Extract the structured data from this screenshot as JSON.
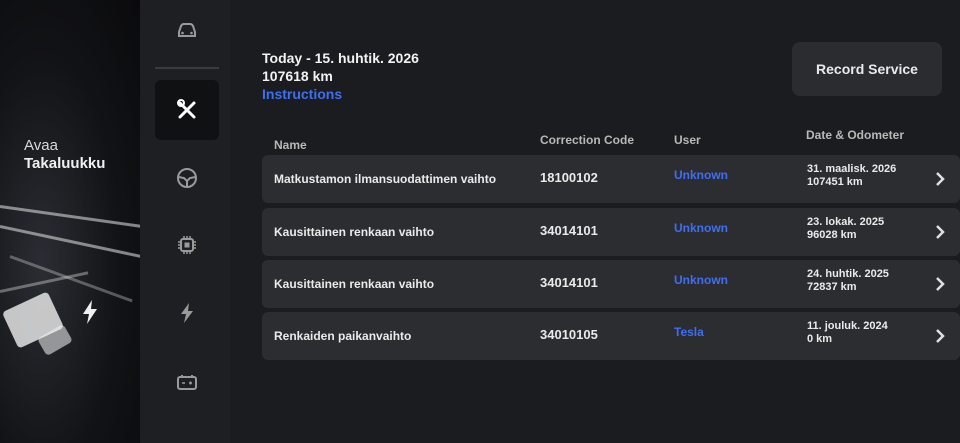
{
  "side_panel": {
    "trunk_label_line1": "Avaa",
    "trunk_label_line2": "Takaluukku"
  },
  "nav": {
    "items": [
      {
        "icon": "car-icon",
        "active": false
      },
      {
        "icon": "wrench-screwdriver-icon",
        "active": true
      },
      {
        "icon": "steering-wheel-icon",
        "active": false
      },
      {
        "icon": "chip-icon",
        "active": false
      },
      {
        "icon": "lightning-icon",
        "active": false
      },
      {
        "icon": "battery-icon",
        "active": false
      }
    ]
  },
  "header": {
    "date": "Today - 15. huhtik. 2026",
    "odometer": "107618 km",
    "instructions_link": "Instructions",
    "record_button": "Record Service"
  },
  "table": {
    "columns": [
      "Name",
      "Correction Code",
      "User",
      "Date & Odometer"
    ],
    "rows": [
      {
        "name": "Matkustamon ilmansuodattimen vaihto",
        "code": "18100102",
        "user": "Unknown",
        "date": "31. maalisk. 2026",
        "odometer": "107451 km"
      },
      {
        "name": "Kausittainen renkaan vaihto",
        "code": "34014101",
        "user": "Unknown",
        "date": "23. lokak. 2025",
        "odometer": "96028 km"
      },
      {
        "name": "Kausittainen renkaan vaihto",
        "code": "34014101",
        "user": "Unknown",
        "date": "24. huhtik. 2025",
        "odometer": "72837 km"
      },
      {
        "name": "Renkaiden paikanvaihto",
        "code": "34010105",
        "user": "Tesla",
        "date": "11. jouluk. 2024",
        "odometer": "0 km"
      }
    ]
  },
  "colors": {
    "accent": "#3e6ff2",
    "background": "#1b1c1f",
    "row": "#2c2d31"
  }
}
